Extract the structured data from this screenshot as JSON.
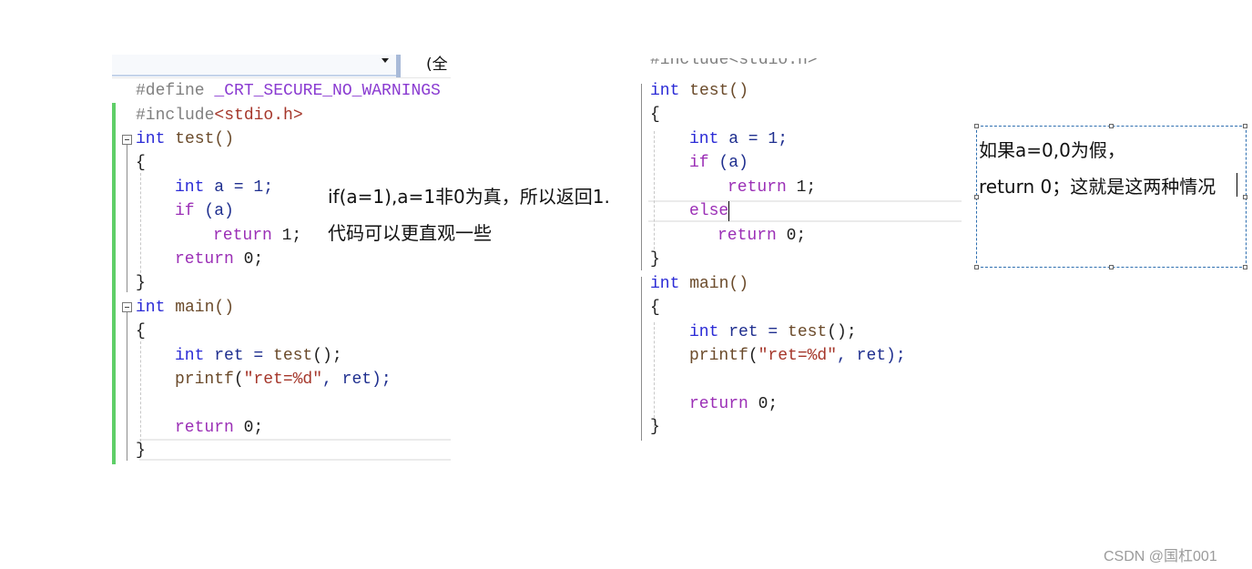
{
  "left_editor": {
    "scope_label": "(全",
    "lines": {
      "l1_a": "#define ",
      "l1_b": "_CRT_SECURE_NO_WARNINGS",
      "l2_a": "#include",
      "l2_b": "<stdio.h>",
      "l3_a": "int",
      "l3_b": " test()",
      "l4": "{",
      "l5_a": "int",
      "l5_b": " a = 1;",
      "l6_a": "if",
      "l6_b": " (a)",
      "l7_a": "return",
      "l7_b": " 1;",
      "l8_a": "return",
      "l8_b": " 0;",
      "l9": "}",
      "l10_a": "int",
      "l10_b": " main()",
      "l11": "{",
      "l12_a": "int",
      "l12_b": " ret = ",
      "l12_c": "test",
      "l12_d": "();",
      "l13_a": "printf",
      "l13_b": "(",
      "l13_c": "\"ret=%d\"",
      "l13_d": ", ret);",
      "l14_a": "return",
      "l14_b": " 0;",
      "l15": "}"
    }
  },
  "note": {
    "line1": "if(a=1),a=1非0为真，所以返回1.",
    "line2": "代码可以更直观一些"
  },
  "right_editor": {
    "lines": {
      "l0": "#include<stdio.h>",
      "l1_a": "int",
      "l1_b": " test()",
      "l2": "{",
      "l3_a": "int",
      "l3_b": " a = 1;",
      "l4_a": "if",
      "l4_b": " (a)",
      "l5_a": "return",
      "l5_b": " 1;",
      "l6": "else",
      "l7_a": "return",
      "l7_b": " 0;",
      "l8": "}",
      "l9_a": "int",
      "l9_b": " main()",
      "l10": "{",
      "l11_a": "int",
      "l11_b": " ret = ",
      "l11_c": "test",
      "l11_d": "();",
      "l12_a": "printf",
      "l12_b": "(",
      "l12_c": "\"ret=%d\"",
      "l12_d": ", ret);",
      "l13_a": "return",
      "l13_b": " 0;",
      "l14": "}"
    }
  },
  "textbox": {
    "line1": "如果a=0,0为假，",
    "line2": "return 0；这就是这两种情况"
  },
  "watermark": "CSDN @国杠001",
  "colors": {
    "keyword": "#2b2bd6",
    "control": "#9b2fb6",
    "string": "#a5362a",
    "change_bar": "#5fcf68",
    "selection_border": "#2e6fb0"
  }
}
